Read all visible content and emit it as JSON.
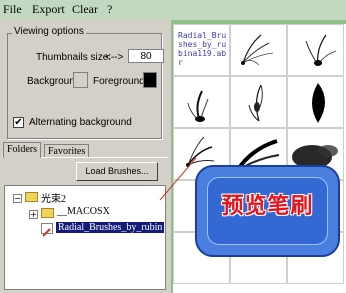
{
  "menu": {
    "file": "File",
    "export": "Export",
    "clear": "Clear",
    "help": "?"
  },
  "viewing_options": {
    "title": "Viewing options",
    "thumb_label": "Thumbnails size:",
    "thumb_arrows": "<-->",
    "thumb_value": "80",
    "background_label": "Background:",
    "foreground_label": "Foreground:",
    "background_color": "#d4d0c8",
    "foreground_color": "#000000",
    "alt_bg_label": "Alternating background",
    "alt_bg_checked": true
  },
  "tabs": {
    "folders": "Folders",
    "favorites": "Favorites"
  },
  "load_button": "Load Brushes...",
  "tree": {
    "root": "光束2",
    "child1": "__MACOSX",
    "child2": "Radial_Brushes_by_rubin"
  },
  "grid": {
    "filename": "Radial_Brushes_by_rubina119.abr"
  },
  "callout": {
    "text": "预览笔刷"
  }
}
